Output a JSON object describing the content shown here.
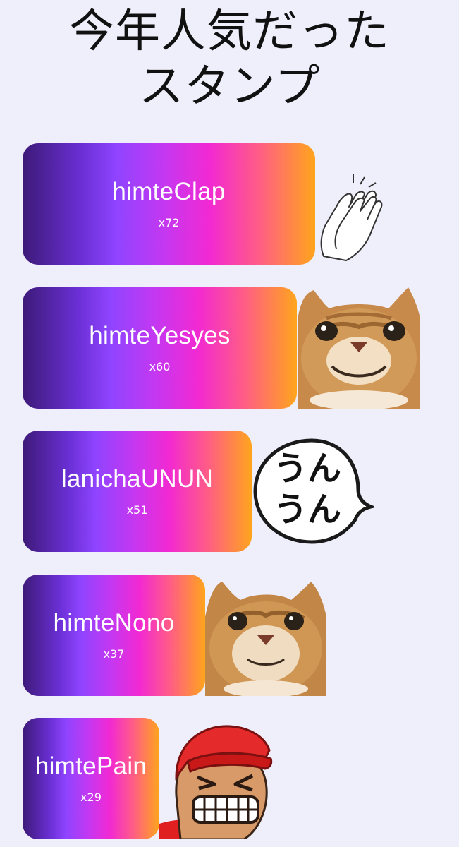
{
  "title": {
    "line1": "今年人気だった",
    "line2": "スタンプ"
  },
  "stamps": [
    {
      "name": "himteClap",
      "count": "x72",
      "icon": "clapping-hands-icon"
    },
    {
      "name": "himteYesyes",
      "count": "x60",
      "icon": "smiling-cat-icon"
    },
    {
      "name": "lanichaUNUN",
      "count": "x51",
      "icon": "speech-bubble-unun-icon"
    },
    {
      "name": "himteNono",
      "count": "x37",
      "icon": "cat-face-closeup-icon"
    },
    {
      "name": "himtePain",
      "count": "x29",
      "icon": "grimacing-man-red-cap-icon"
    }
  ],
  "bubble_text": {
    "line1": "うん",
    "line2": "うん"
  },
  "colors": {
    "background": "#efeefb",
    "gradient": [
      "#3d1a78",
      "#8f44ff",
      "#f229d2",
      "#ffa51c"
    ],
    "title_text": "#111111",
    "bar_text": "#ffffff"
  }
}
